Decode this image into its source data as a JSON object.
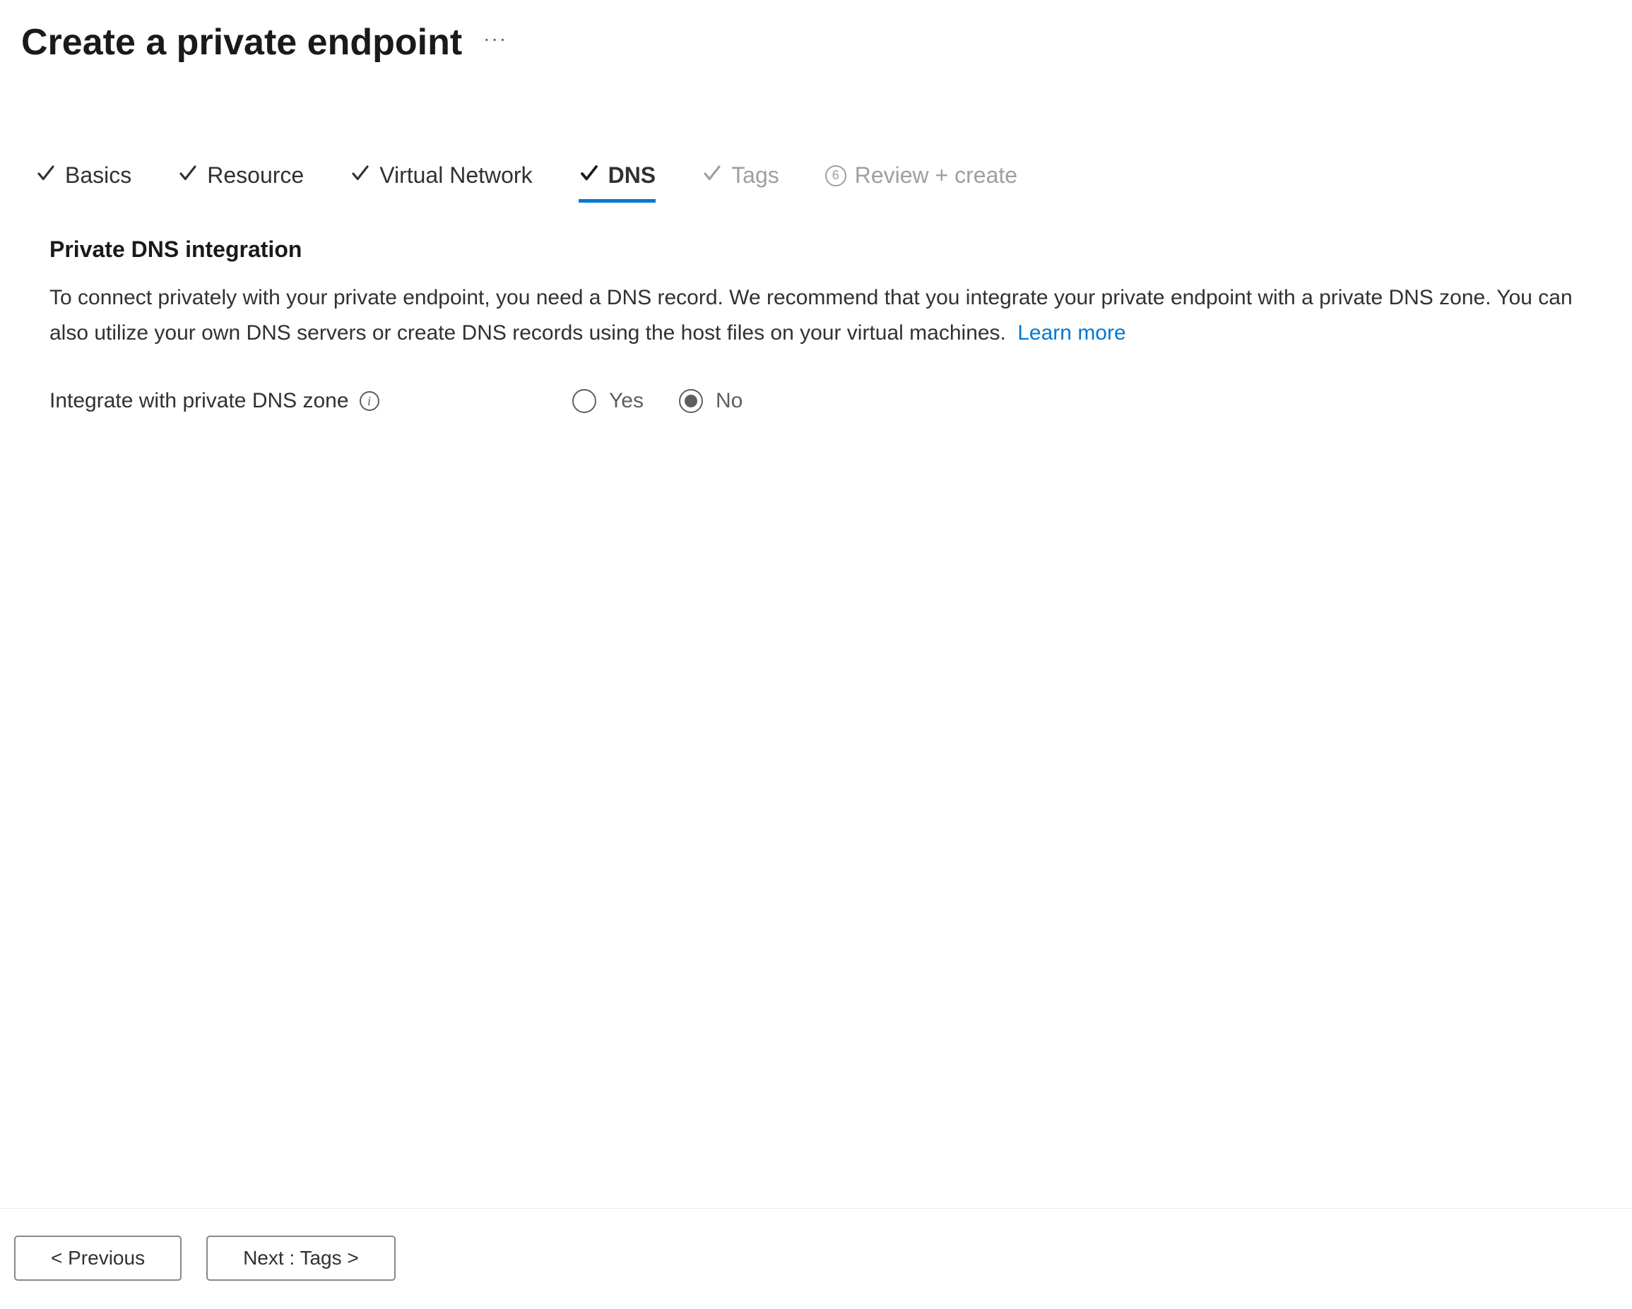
{
  "header": {
    "title": "Create a private endpoint"
  },
  "tabs": [
    {
      "label": "Basics",
      "state": "completed"
    },
    {
      "label": "Resource",
      "state": "completed"
    },
    {
      "label": "Virtual Network",
      "state": "completed"
    },
    {
      "label": "DNS",
      "state": "active"
    },
    {
      "label": "Tags",
      "state": "disabled"
    },
    {
      "label": "Review + create",
      "state": "disabled",
      "number": "6"
    }
  ],
  "section": {
    "title": "Private DNS integration",
    "description": "To connect privately with your private endpoint, you need a DNS record. We recommend that you integrate your private endpoint with a private DNS zone. You can also utilize your own DNS servers or create DNS records using the host files on your virtual machines.",
    "learn_more_label": "Learn more"
  },
  "form": {
    "integrate_label": "Integrate with private DNS zone",
    "options": {
      "yes": "Yes",
      "no": "No"
    },
    "selected": "no"
  },
  "footer": {
    "previous_label": "< Previous",
    "next_label": "Next : Tags >"
  }
}
